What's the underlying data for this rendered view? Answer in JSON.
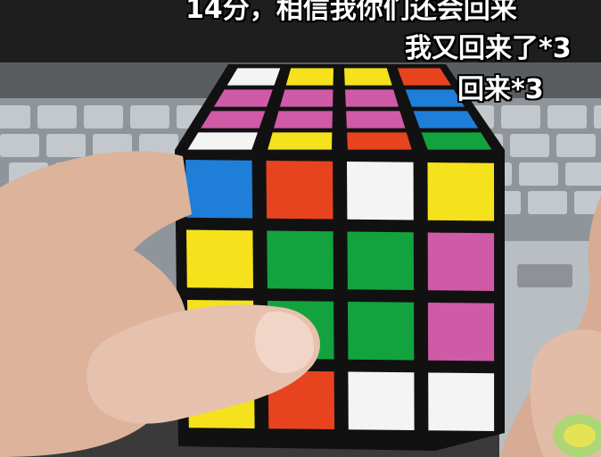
{
  "comments": [
    {
      "text": "14分，相信我你们还会回来"
    },
    {
      "text": "我又回来了*3"
    },
    {
      "text": "回来*3"
    }
  ],
  "colors": {
    "white": "#f4f4f4",
    "yellow": "#f6e21c",
    "magenta": "#cf5aa6",
    "red": "#e8431f",
    "blue": "#1f7fd8",
    "green": "#12a33e",
    "cube_body": "#111111",
    "skin": "#e2b49a",
    "keyboard": "#9aa0a6"
  },
  "cube": {
    "top_face": [
      [
        "white",
        "yellow",
        "yellow",
        "red"
      ],
      [
        "magenta",
        "magenta",
        "magenta",
        "blue"
      ],
      [
        "magenta",
        "magenta",
        "magenta",
        "blue"
      ],
      [
        "white",
        "yellow",
        "red",
        "green"
      ]
    ],
    "front_face": [
      [
        "blue",
        "red",
        "white",
        "yellow"
      ],
      [
        "yellow",
        "green",
        "green",
        "magenta"
      ],
      [
        "yellow",
        "green",
        "green",
        "magenta"
      ],
      [
        "yellow",
        "red",
        "white",
        "white"
      ]
    ]
  }
}
